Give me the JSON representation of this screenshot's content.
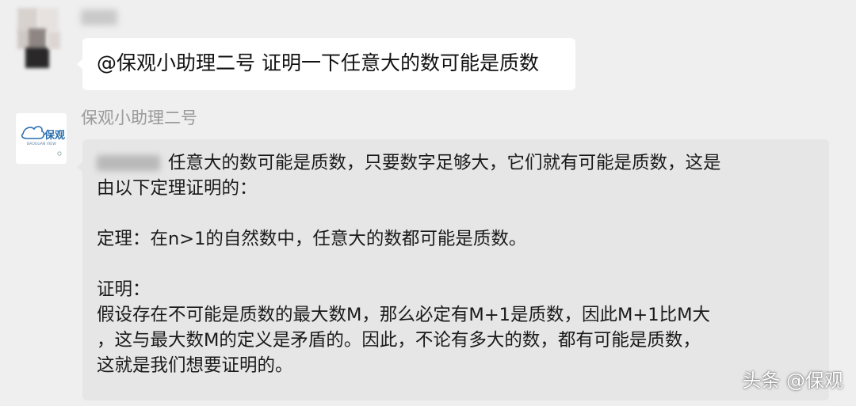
{
  "chat": {
    "user_message": {
      "text": "@保观小助理二号 证明一下任意大的数可能是质数"
    },
    "bot": {
      "name": "保观小助理二号",
      "avatar": {
        "logo_text": "保观",
        "logo_subtext": "BAOGUAN VIEW",
        "brand_color": "#2a6fb0"
      },
      "message_lines": [
        "任意大的数可能是质数，只要数字足够大，它们就有可能是质数，这是",
        "由以下定理证明的：",
        "",
        "定理：在n>1的自然数中，任意大的数都可能是质数。",
        "",
        "证明：",
        "假设存在不可能是质数的最大数M，那么必定有M+1是质数，因此M+1比M大",
        "，这与最大数M的定义是矛盾的。因此，不论有多大的数，都有可能是质数，",
        "这就是我们想要证明的。"
      ]
    }
  },
  "watermark": "头条 @保观",
  "colors": {
    "background": "#efefef",
    "user_bubble": "#ffffff",
    "bot_bubble": "#e6e6e6",
    "name_text": "#9a9a9a"
  }
}
